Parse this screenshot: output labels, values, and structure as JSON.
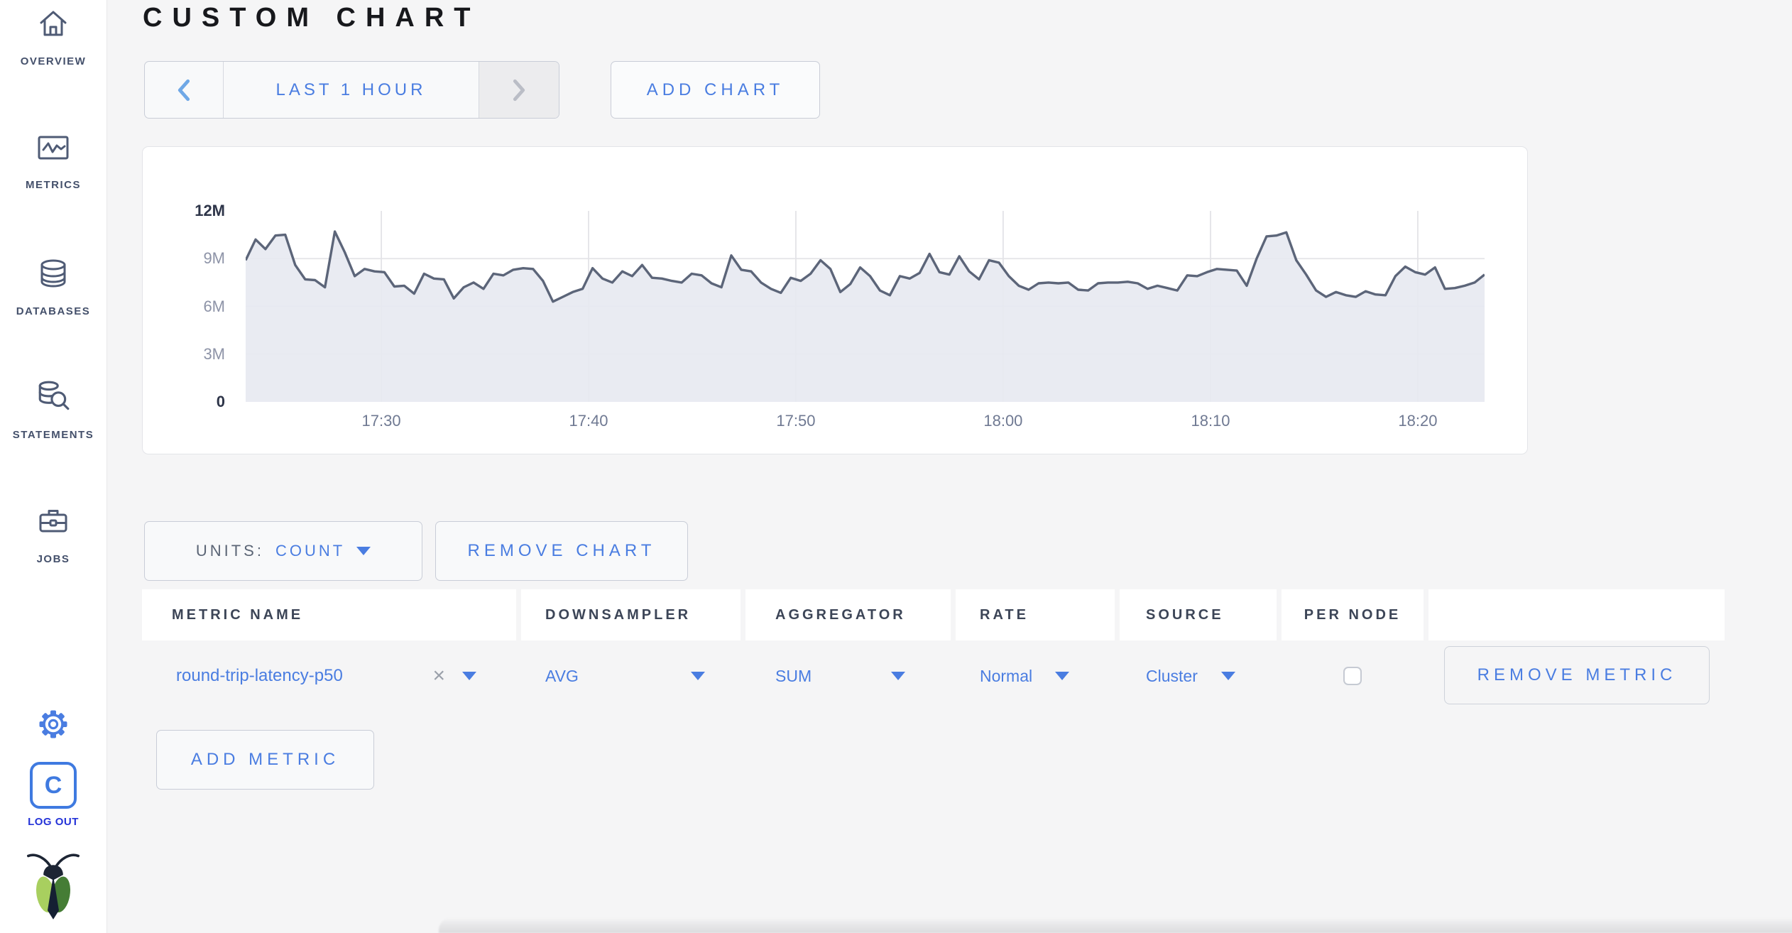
{
  "header": {
    "title": "CUSTOM CHART"
  },
  "colors": {
    "accent_blue": "#4a7de1",
    "logout_blue": "#2433d8",
    "chart_line": "#5c6579",
    "chart_fill": "#eaecf2",
    "page_background": "#f5f5f6"
  },
  "sidebar": {
    "items": [
      {
        "label": "OVERVIEW",
        "icon": "home-icon"
      },
      {
        "label": "METRICS",
        "icon": "metrics-icon"
      },
      {
        "label": "DATABASES",
        "icon": "databases-icon"
      },
      {
        "label": "STATEMENTS",
        "icon": "statements-icon"
      },
      {
        "label": "JOBS",
        "icon": "jobs-icon"
      }
    ],
    "footer": {
      "settings_icon": "gear-icon",
      "logo_letter": "C",
      "logout_label": "LOG OUT",
      "brand_icon": "cockroach-bug-icon"
    }
  },
  "toolbar": {
    "time_window_label": "LAST 1 HOUR",
    "prev_icon": "chevron-left-icon",
    "next_icon": "chevron-right-icon",
    "add_chart_label": "ADD CHART"
  },
  "chart_controls": {
    "units_label": "UNITS:",
    "units_value": "COUNT",
    "remove_chart_label": "REMOVE CHART"
  },
  "metrics_table": {
    "columns": [
      "METRIC NAME",
      "DOWNSAMPLER",
      "AGGREGATOR",
      "RATE",
      "SOURCE",
      "PER NODE"
    ],
    "rows": [
      {
        "metric_name": "round-trip-latency-p50",
        "downsampler": "AVG",
        "aggregator": "SUM",
        "rate": "Normal",
        "source": "Cluster",
        "per_node_checked": false,
        "remove_label": "REMOVE METRIC"
      }
    ],
    "add_metric_label": "ADD METRIC"
  },
  "chart_data": {
    "type": "area",
    "title": "",
    "x_span": "approx 17:23 - 18:23 (last 1 hour)",
    "ylim_millions": [
      0,
      12
    ],
    "grid_y_millions": [
      3,
      6,
      9
    ],
    "y_ticks": [
      {
        "value_millions": 0,
        "label": "0"
      },
      {
        "value_millions": 3,
        "label": "3M"
      },
      {
        "value_millions": 6,
        "label": "6M"
      },
      {
        "value_millions": 9,
        "label": "9M"
      },
      {
        "value_millions": 12,
        "label": "12M"
      }
    ],
    "x_ticks": [
      {
        "frac": 0.1095,
        "label": "17:30"
      },
      {
        "frac": 0.2768,
        "label": "17:40"
      },
      {
        "frac": 0.4441,
        "label": "17:50"
      },
      {
        "frac": 0.6114,
        "label": "18:00"
      },
      {
        "frac": 0.7788,
        "label": "18:10"
      },
      {
        "frac": 0.9461,
        "label": "18:20"
      }
    ],
    "legend": "none",
    "series": [
      {
        "name": "round-trip-latency-p50",
        "color": "#5c6579",
        "fill": "rgba(231,233,241,0.9)",
        "values_millions": [
          8.9,
          10.2,
          9.6,
          10.45,
          10.5,
          8.6,
          7.7,
          7.65,
          7.2,
          10.7,
          9.4,
          7.9,
          8.35,
          8.2,
          8.15,
          7.25,
          7.3,
          6.8,
          8.05,
          7.75,
          7.7,
          6.5,
          7.2,
          7.5,
          7.1,
          8.05,
          7.95,
          8.3,
          8.4,
          8.35,
          7.6,
          6.3,
          6.6,
          6.9,
          7.1,
          8.4,
          7.75,
          7.5,
          8.2,
          7.9,
          8.6,
          7.8,
          7.75,
          7.6,
          7.5,
          8.05,
          7.95,
          7.45,
          7.2,
          9.2,
          8.3,
          8.2,
          7.5,
          7.1,
          6.85,
          7.8,
          7.6,
          8.05,
          8.9,
          8.35,
          6.9,
          7.4,
          8.45,
          7.9,
          7.0,
          6.7,
          7.9,
          7.75,
          8.1,
          9.3,
          8.15,
          8.0,
          9.15,
          8.2,
          7.7,
          8.9,
          8.75,
          7.9,
          7.3,
          7.05,
          7.45,
          7.5,
          7.45,
          7.5,
          7.05,
          7.0,
          7.45,
          7.5,
          7.5,
          7.55,
          7.45,
          7.1,
          7.3,
          7.15,
          7.0,
          7.95,
          7.9,
          8.15,
          8.35,
          8.3,
          8.25,
          7.3,
          9.0,
          10.4,
          10.45,
          10.65,
          8.9,
          8.0,
          7.0,
          6.6,
          6.9,
          6.7,
          6.6,
          6.95,
          6.75,
          6.7,
          7.9,
          8.5,
          8.15,
          8.0,
          8.45,
          7.1,
          7.15,
          7.3,
          7.5,
          8.0
        ]
      }
    ]
  }
}
